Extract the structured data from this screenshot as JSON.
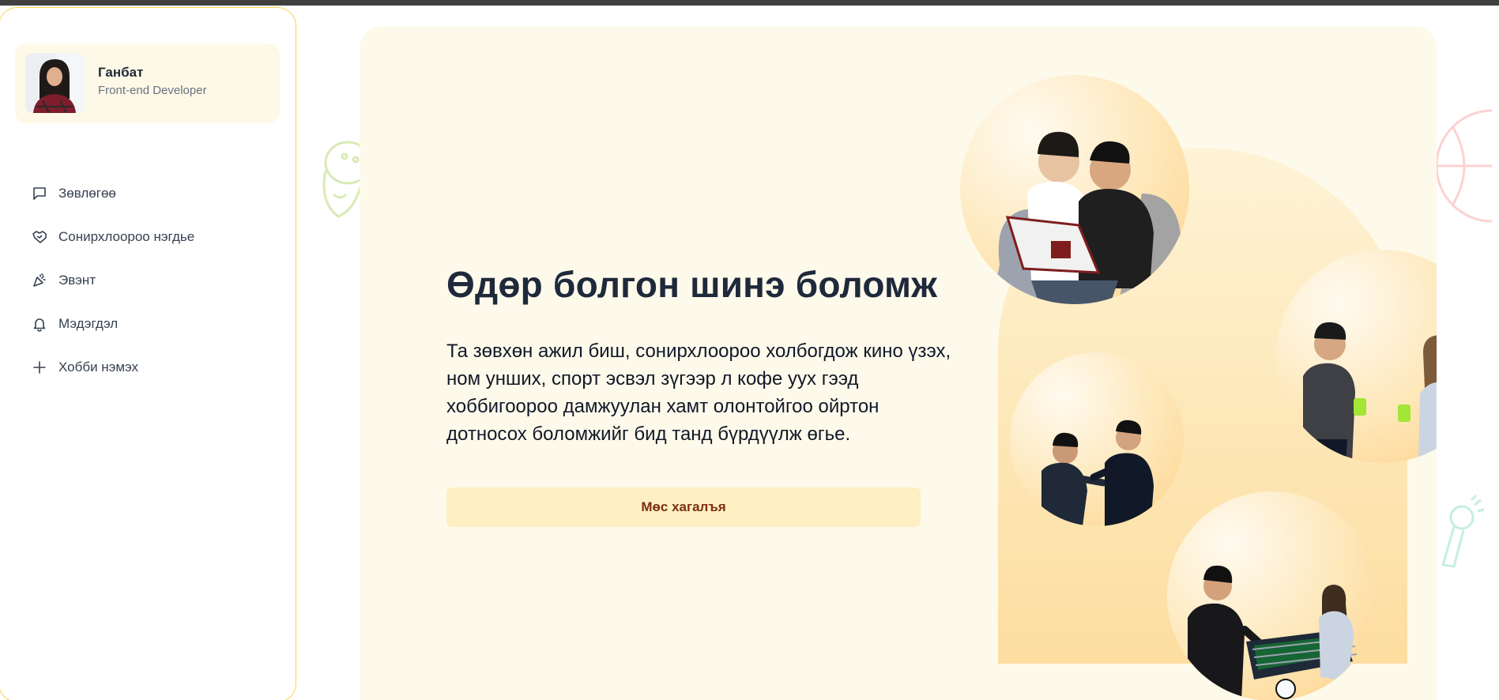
{
  "profile": {
    "name": "Ганбат",
    "role": "Front-end Developer"
  },
  "sidebar": {
    "items": [
      {
        "label": "Зөвлөгөө",
        "icon": "chat-bubble-icon"
      },
      {
        "label": "Сонирхлоороо нэгдье",
        "icon": "handshake-icon"
      },
      {
        "label": "Эвэнт",
        "icon": "party-popper-icon"
      },
      {
        "label": "Мэдэгдэл",
        "icon": "bell-icon"
      },
      {
        "label": "Хобби нэмэх",
        "icon": "plus-icon"
      }
    ]
  },
  "hero": {
    "title": "Өдөр болгон шинэ боломж",
    "description": "Та зөвхөн ажил биш, сонирхлоороо холбогдож кино үзэх, ном унших, спорт эсвэл зүгээр л кофе уух гээд хоббигоороо дамжуулан хамт олонтойгоо ойртон дотносох боломжийг бид танд бүрдүүлж өгье.",
    "button_label": "Мөс хагалъя"
  },
  "colors": {
    "accent": "#fcd34d",
    "card_bg": "#fefaeb",
    "button_bg": "#fef0c2",
    "button_text": "#7c2d12"
  }
}
